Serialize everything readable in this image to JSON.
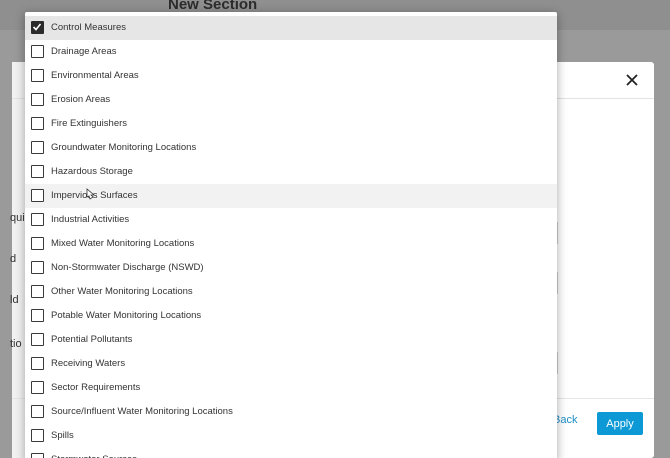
{
  "background": {
    "section_title": "New Section"
  },
  "modal": {
    "close_icon": "close-icon",
    "side_fragments": [
      "qui",
      "d",
      "ld",
      "tio"
    ],
    "back_label": "Back",
    "apply_label": "Apply"
  },
  "dropdown": {
    "options": [
      {
        "label": "Control Measures",
        "checked": true
      },
      {
        "label": "Drainage Areas",
        "checked": false
      },
      {
        "label": "Environmental Areas",
        "checked": false
      },
      {
        "label": "Erosion Areas",
        "checked": false
      },
      {
        "label": "Fire Extinguishers",
        "checked": false
      },
      {
        "label": "Groundwater Monitoring Locations",
        "checked": false
      },
      {
        "label": "Hazardous Storage",
        "checked": false
      },
      {
        "label": "Impervious Surfaces",
        "checked": false
      },
      {
        "label": "Industrial Activities",
        "checked": false
      },
      {
        "label": "Mixed Water Monitoring Locations",
        "checked": false
      },
      {
        "label": "Non-Stormwater Discharge (NSWD)",
        "checked": false
      },
      {
        "label": "Other Water Monitoring Locations",
        "checked": false
      },
      {
        "label": "Potable Water Monitoring Locations",
        "checked": false
      },
      {
        "label": "Potential Pollutants",
        "checked": false
      },
      {
        "label": "Receiving Waters",
        "checked": false
      },
      {
        "label": "Sector Requirements",
        "checked": false
      },
      {
        "label": "Source/Influent Water Monitoring Locations",
        "checked": false
      },
      {
        "label": "Spills",
        "checked": false
      },
      {
        "label": "Stormwater Sources",
        "checked": false
      }
    ],
    "hovered_index": 7
  },
  "colors": {
    "accent": "#0d99d6",
    "selected_row": "#e6e6e6",
    "hover_row": "#f2f2f2"
  }
}
